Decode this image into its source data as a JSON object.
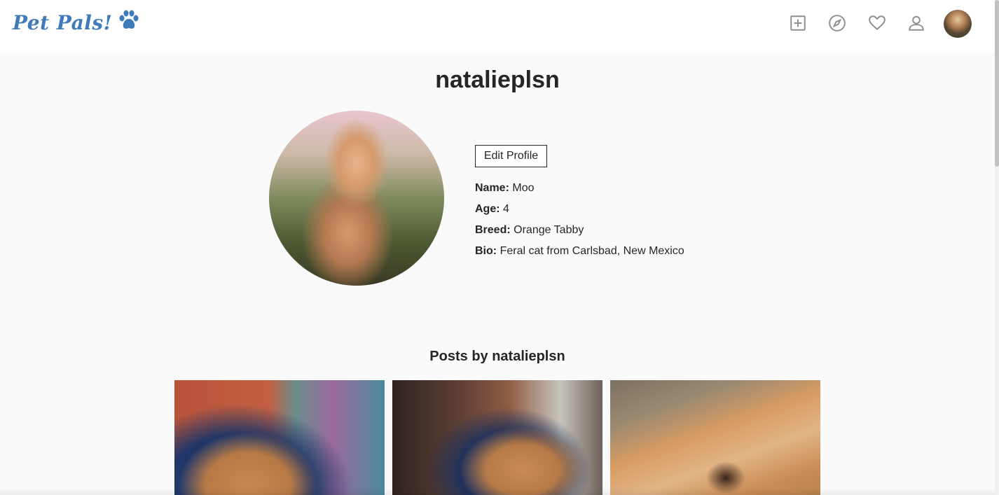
{
  "app": {
    "logo_text": "Pet Pals!",
    "logo_icon": "paw-icon",
    "brand_color": "#3e7bb8"
  },
  "nav": {
    "icons": [
      "add-post-icon",
      "explore-compass-icon",
      "heart-icon",
      "user-profile-icon"
    ],
    "avatar": "avatar"
  },
  "profile": {
    "username": "natalieplsn",
    "edit_button": "Edit Profile",
    "name_label": "Name:",
    "name_value": "Moo",
    "age_label": "Age:",
    "age_value": "4",
    "breed_label": "Breed:",
    "breed_value": "Orange Tabby",
    "bio_label": "Bio:",
    "bio_value": "Feral cat from Carlsbad, New Mexico"
  },
  "posts": {
    "title": "Posts by natalieplsn",
    "items": [
      "post-1",
      "post-2",
      "post-3"
    ]
  }
}
